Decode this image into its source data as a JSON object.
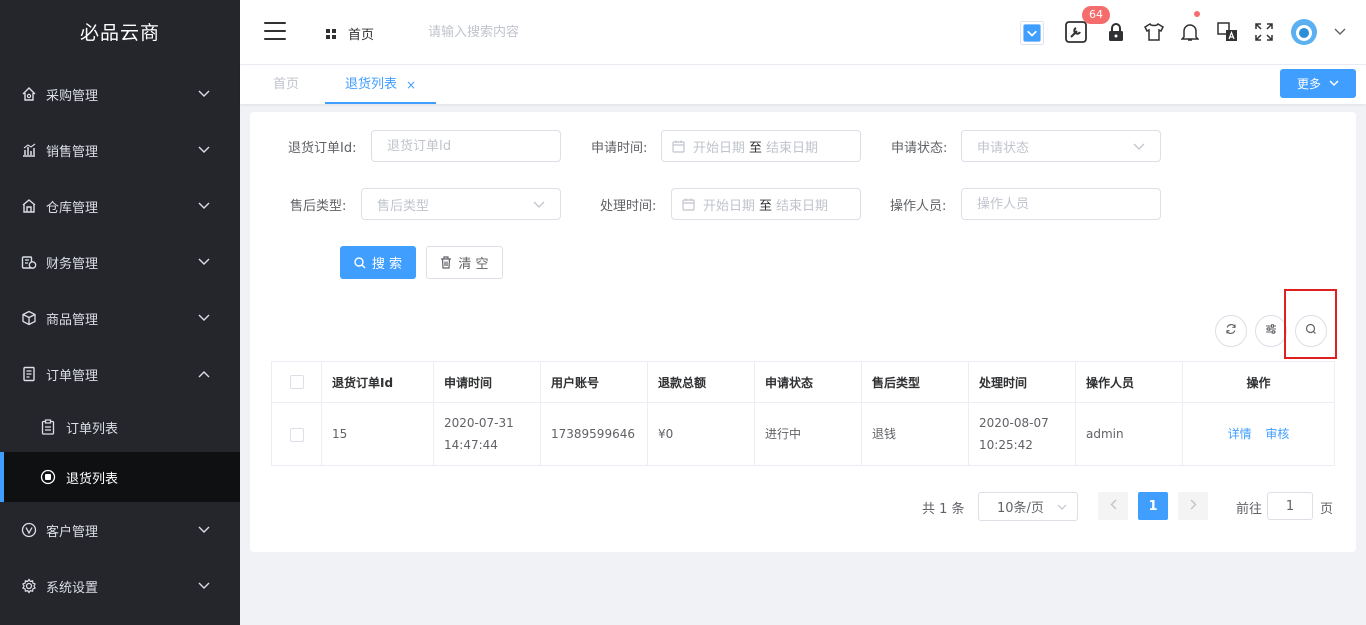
{
  "app": {
    "logo": "必品云商"
  },
  "sidebar": {
    "items": [
      {
        "label": "采购管理"
      },
      {
        "label": "销售管理"
      },
      {
        "label": "仓库管理"
      },
      {
        "label": "财务管理"
      },
      {
        "label": "商品管理"
      },
      {
        "label": "订单管理"
      },
      {
        "label": "客户管理"
      },
      {
        "label": "系统设置"
      }
    ],
    "order_sub": [
      {
        "label": "订单列表"
      },
      {
        "label": "退货列表"
      }
    ]
  },
  "header": {
    "home": "首页",
    "search_placeholder": "请输入搜索内容",
    "badge_count": "64"
  },
  "tabs": {
    "home": "首页",
    "current": "退货列表",
    "close": "×",
    "more": "更多"
  },
  "filters": {
    "order_id_label": "退货订单Id:",
    "order_id_placeholder": "退货订单Id",
    "apply_time_label": "申请时间:",
    "start_date": "开始日期",
    "range_sep": "至",
    "end_date": "结束日期",
    "apply_status_label": "申请状态:",
    "apply_status_placeholder": "申请状态",
    "after_sale_type_label": "售后类型:",
    "after_sale_type_placeholder": "售后类型",
    "process_time_label": "处理时间:",
    "operator_label": "操作人员:",
    "operator_placeholder": "操作人员",
    "search_button": "搜 索",
    "clear_button": "清 空"
  },
  "table": {
    "columns": [
      "退货订单Id",
      "申请时间",
      "用户账号",
      "退款总额",
      "申请状态",
      "售后类型",
      "处理时间",
      "操作人员",
      "操作"
    ],
    "rows": [
      {
        "id": "15",
        "apply_time": "2020-07-31 14:47:44",
        "account": "17389599646",
        "amount": "¥0",
        "status": "进行中",
        "type": "退钱",
        "process_time": "2020-08-07 10:25:42",
        "operator": "admin",
        "action_detail": "详情",
        "action_review": "审核"
      }
    ]
  },
  "pagination": {
    "total": "共 1 条",
    "page_size": "10条/页",
    "current_page": "1",
    "goto_label": "前往",
    "goto_value": "1",
    "goto_unit": "页"
  },
  "colors": {
    "primary": "#409eff",
    "sidebar_bg": "#24262b",
    "badge": "#f56c6c",
    "highlight": "#e02020"
  }
}
